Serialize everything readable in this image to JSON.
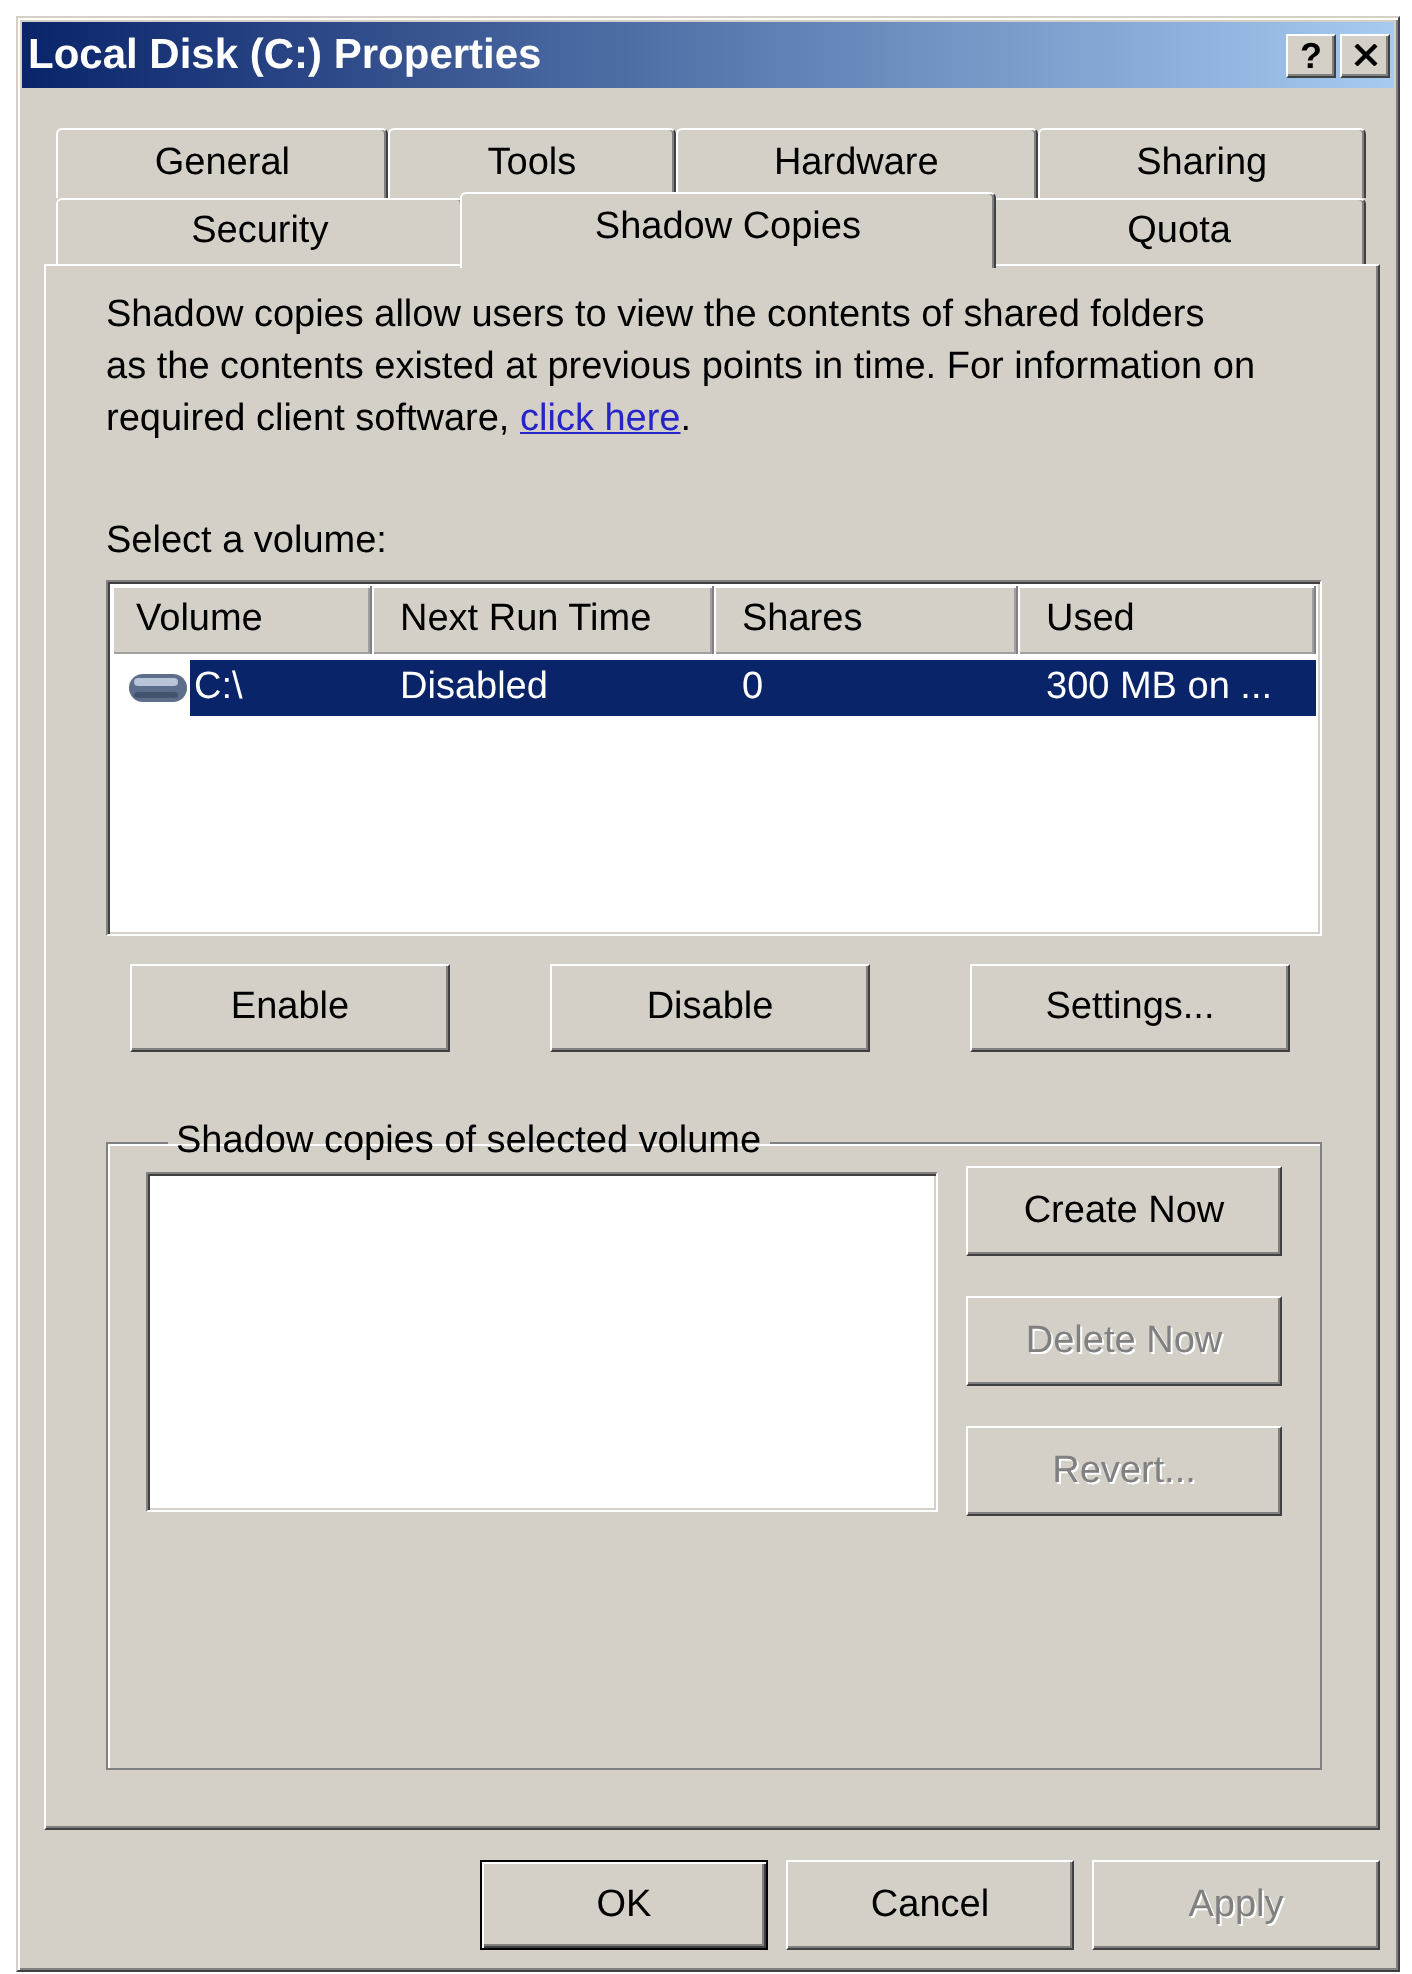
{
  "window": {
    "title": "Local Disk (C:) Properties",
    "help_button": "?"
  },
  "tab_rows": [
    {
      "tabs": [
        {
          "label": "General",
          "selected": false
        },
        {
          "label": "Tools",
          "selected": false
        },
        {
          "label": "Hardware",
          "selected": false
        },
        {
          "label": "Sharing",
          "selected": false
        }
      ]
    },
    {
      "tabs": [
        {
          "label": "Security",
          "selected": false
        },
        {
          "label": "Shadow Copies",
          "selected": true
        },
        {
          "label": "Quota",
          "selected": false
        }
      ]
    }
  ],
  "description": {
    "lines": [
      "Shadow copies allow users to view the contents of shared folders",
      "as the contents existed at previous points in time. For information on",
      "required client software,"
    ],
    "link": "click here",
    "after": "."
  },
  "volume_list": {
    "label": "Select a volume:",
    "columns": [
      "Volume",
      "Next Run Time",
      "Shares",
      "Used"
    ],
    "rows": [
      {
        "cells": [
          "C:\\",
          "Disabled",
          "0",
          "300 MB on ..."
        ],
        "selected": true
      }
    ]
  },
  "volume_buttons": [
    {
      "label": "Enable",
      "disabled": false
    },
    {
      "label": "Disable",
      "disabled": false
    },
    {
      "label": "Settings...",
      "disabled": false
    }
  ],
  "shadow_copies": {
    "title": "Shadow copies of selected volume",
    "buttons": [
      {
        "label": "Create Now",
        "disabled": false
      },
      {
        "label": "Delete Now",
        "disabled": true
      },
      {
        "label": "Revert...",
        "disabled": true
      }
    ]
  },
  "dialog_buttons": [
    {
      "label": "OK",
      "default": true,
      "disabled": false
    },
    {
      "label": "Cancel",
      "default": false,
      "disabled": false
    },
    {
      "label": "Apply",
      "default": false,
      "disabled": true
    }
  ]
}
